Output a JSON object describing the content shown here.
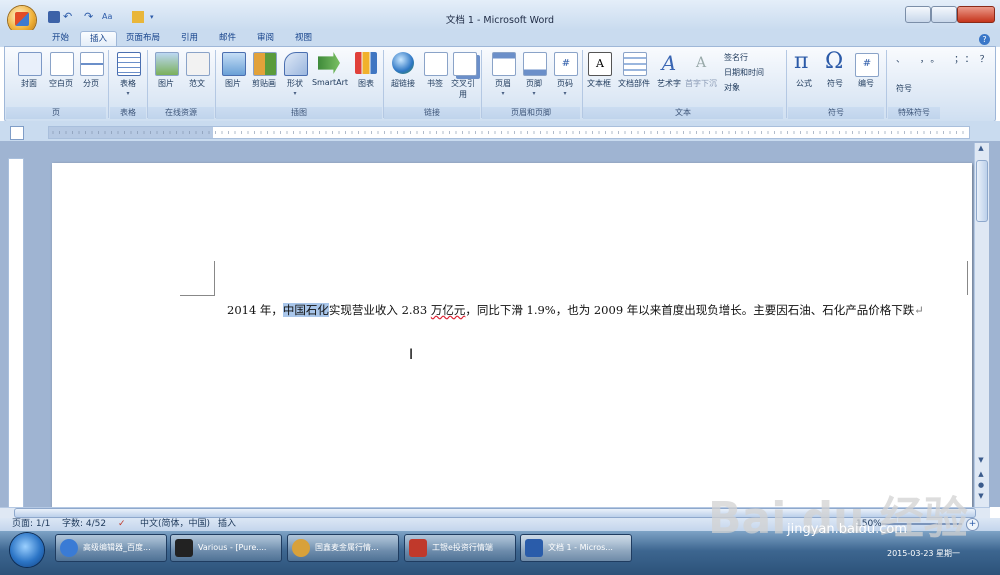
{
  "window": {
    "title": "文档 1 - Microsoft Word"
  },
  "tabs": [
    "开始",
    "插入",
    "页面布局",
    "引用",
    "邮件",
    "审阅",
    "视图"
  ],
  "active_tab": "插入",
  "ribbon": {
    "groups": [
      {
        "name": "页",
        "items": [
          {
            "label": "封面",
            "icon": "cover-page-icon"
          },
          {
            "label": "空白页",
            "icon": "blank-page-icon"
          },
          {
            "label": "分页",
            "icon": "page-break-icon"
          }
        ]
      },
      {
        "name": "表格",
        "items": [
          {
            "label": "表格",
            "icon": "table-icon"
          }
        ]
      },
      {
        "name": "在线资源",
        "items": [
          {
            "label": "图片",
            "icon": "online-picture-icon"
          },
          {
            "label": "范文",
            "icon": "template-icon"
          }
        ]
      },
      {
        "name": "插图",
        "items": [
          {
            "label": "图片",
            "icon": "picture-icon"
          },
          {
            "label": "剪贴画",
            "icon": "clipart-icon"
          },
          {
            "label": "形状",
            "icon": "shapes-icon"
          },
          {
            "label": "SmartArt",
            "icon": "smartart-icon"
          },
          {
            "label": "图表",
            "icon": "chart-icon"
          }
        ]
      },
      {
        "name": "链接",
        "items": [
          {
            "label": "超链接",
            "icon": "hyperlink-icon"
          },
          {
            "label": "书签",
            "icon": "bookmark-icon"
          },
          {
            "label": "交叉引用",
            "icon": "cross-reference-icon"
          }
        ]
      },
      {
        "name": "页眉和页脚",
        "items": [
          {
            "label": "页眉",
            "icon": "header-icon"
          },
          {
            "label": "页脚",
            "icon": "footer-icon"
          },
          {
            "label": "页码",
            "icon": "page-number-icon"
          }
        ]
      },
      {
        "name": "文本",
        "items": [
          {
            "label": "文本框",
            "icon": "textbox-icon"
          },
          {
            "label": "文档部件",
            "icon": "quickparts-icon"
          },
          {
            "label": "艺术字",
            "icon": "wordart-icon"
          },
          {
            "label": "首字下沉",
            "icon": "dropcap-icon"
          }
        ],
        "small": [
          {
            "label": "签名行",
            "icon": "signature-icon"
          },
          {
            "label": "日期和时间",
            "icon": "datetime-icon"
          },
          {
            "label": "对象",
            "icon": "object-icon"
          }
        ]
      },
      {
        "name": "符号",
        "items": [
          {
            "label": "公式",
            "icon": "equation-icon"
          },
          {
            "label": "符号",
            "icon": "symbol-icon"
          },
          {
            "label": "编号",
            "icon": "numbering-icon"
          }
        ]
      },
      {
        "name": "特殊符号",
        "items": [
          {
            "label": "符号",
            "icon": "special-symbol-icon"
          }
        ]
      }
    ]
  },
  "document": {
    "text_before": "2014 年，",
    "selected": "中国石化",
    "text_mid": "实现营业收入 2.83 ",
    "squiggly": "万亿元",
    "text_after": "，同比下滑 1.9%，也为 2009 年以来首度出现负增长。主要因石油、石化产品价格下跌",
    "paragraph_mark": "↵"
  },
  "statusbar": {
    "page": "页面: 1/1",
    "words": "字数: 4/52",
    "language": "中文(简体，中国)",
    "mode": "插入",
    "zoom": "150%"
  },
  "taskbar": {
    "items": [
      {
        "label": "高级编辑器_百度...",
        "color": "#3a7bd5"
      },
      {
        "label": "Various - [Pure....",
        "color": "#222222"
      },
      {
        "label": "国鑫麦金属行情...",
        "color": "#d8a13a"
      },
      {
        "label": "工银e投资行情端",
        "color": "#c0392b"
      },
      {
        "label": "文档 1 - Micros...",
        "color": "#2a5caa"
      }
    ],
    "date": "2015-03-23 星期一"
  },
  "watermark": {
    "text": "Bai du 经验",
    "url": "jingyan.baidu.com"
  }
}
